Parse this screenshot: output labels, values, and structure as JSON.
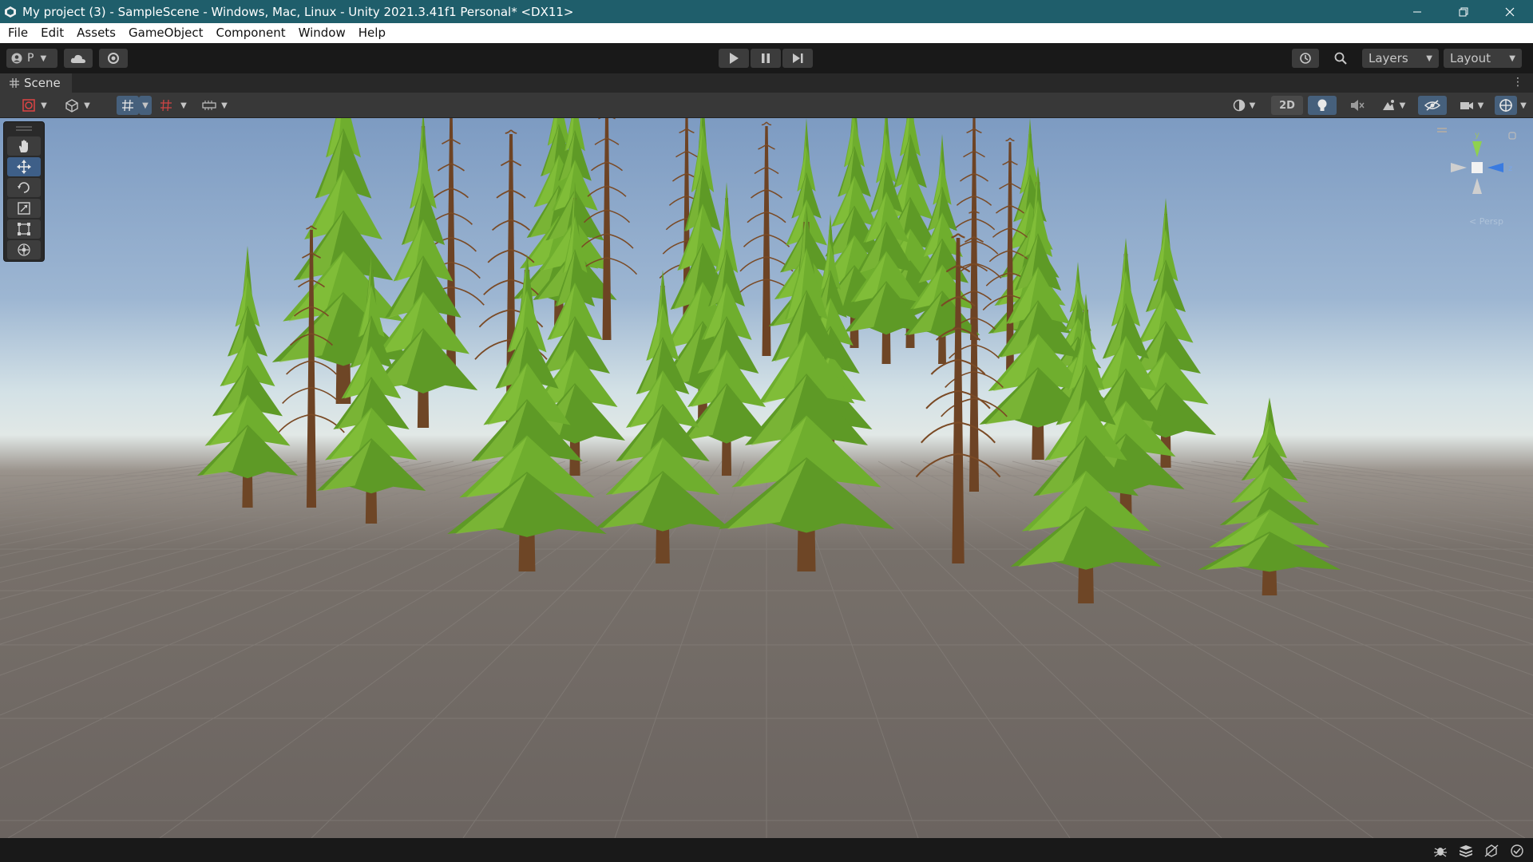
{
  "window": {
    "title": "My project (3) - SampleScene - Windows, Mac, Linux - Unity 2021.3.41f1 Personal* <DX11>",
    "titlebar_color": "#1f5e6b",
    "controls": [
      "minimize-icon",
      "restore-icon",
      "close-icon"
    ]
  },
  "menu": {
    "items": [
      "File",
      "Edit",
      "Assets",
      "GameObject",
      "Component",
      "Window",
      "Help"
    ]
  },
  "toolbar": {
    "account_label": "P",
    "layers_label": "Layers",
    "layout_label": "Layout",
    "play_controls": [
      "play-icon",
      "pause-icon",
      "step-icon"
    ]
  },
  "scene": {
    "tab_label": "Scene",
    "mode_2d_label": "2D",
    "gizmo_axes": [
      "y",
      "z"
    ],
    "gizmo_projection": "< Persp"
  },
  "tools": [
    "hand-tool",
    "move-tool",
    "rotate-tool",
    "scale-tool",
    "rect-tool",
    "transform-tool"
  ],
  "colors": {
    "accent": "#3e5f88",
    "sky_top": "#7f9dc4",
    "horizon": "#d6e3e6",
    "ground": "#6e6661",
    "foliage": "#6fae2e",
    "trunk": "#7a4a25"
  }
}
